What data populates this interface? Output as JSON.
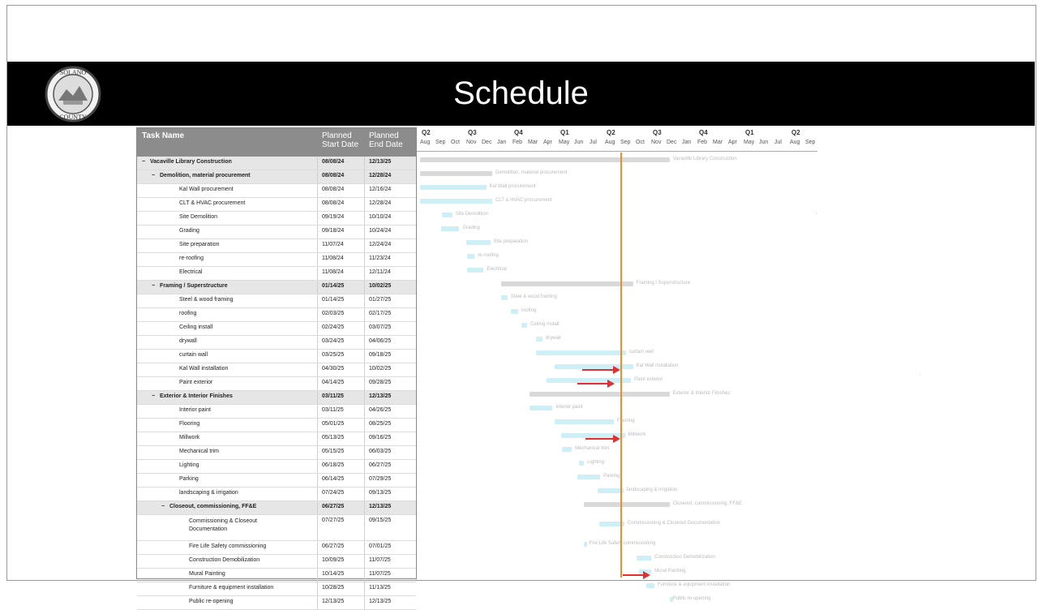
{
  "slide": {
    "title": "Schedule",
    "seal_text_top": "SOLANO",
    "seal_text_bottom": "COUNTY"
  },
  "table": {
    "headers": {
      "task": "Task Name",
      "start_line1": "Planned",
      "start_line2": "Start Date",
      "end_line1": "Planned",
      "end_line2": "End Date"
    },
    "rows": [
      {
        "name": "Vacaville Library Construction",
        "start": "08/08/24",
        "end": "12/13/25",
        "level": 0,
        "group": true,
        "toggle": "−"
      },
      {
        "name": "Demolition, material procurement",
        "start": "08/08/24",
        "end": "12/28/24",
        "level": 1,
        "group": true,
        "toggle": "−"
      },
      {
        "name": "Kal Wall procurement",
        "start": "08/08/24",
        "end": "12/16/24",
        "level": 2
      },
      {
        "name": "CLT & HVAC procurement",
        "start": "08/08/24",
        "end": "12/28/24",
        "level": 2
      },
      {
        "name": "Site Demolition",
        "start": "09/19/24",
        "end": "10/10/24",
        "level": 2
      },
      {
        "name": "Grading",
        "start": "09/18/24",
        "end": "10/24/24",
        "level": 2
      },
      {
        "name": "Site preparation",
        "start": "11/07/24",
        "end": "12/24/24",
        "level": 2
      },
      {
        "name": "re-roofing",
        "start": "11/08/24",
        "end": "11/23/24",
        "level": 2
      },
      {
        "name": "Electrical",
        "start": "11/08/24",
        "end": "12/11/24",
        "level": 2
      },
      {
        "name": "Framing / Superstructure",
        "start": "01/14/25",
        "end": "10/02/25",
        "level": 1,
        "group": true,
        "toggle": "−"
      },
      {
        "name": "Steel & wood framing",
        "start": "01/14/25",
        "end": "01/27/25",
        "level": 2
      },
      {
        "name": "roofing",
        "start": "02/03/25",
        "end": "02/17/25",
        "level": 2
      },
      {
        "name": "Ceiling install",
        "start": "02/24/25",
        "end": "03/07/25",
        "level": 2
      },
      {
        "name": "drywall",
        "start": "03/24/25",
        "end": "04/06/25",
        "level": 2
      },
      {
        "name": "curtain wall",
        "start": "03/25/25",
        "end": "09/18/25",
        "level": 2
      },
      {
        "name": "Kal Wall installation",
        "start": "04/30/25",
        "end": "10/02/25",
        "level": 2
      },
      {
        "name": "Paint exterior",
        "start": "04/14/25",
        "end": "09/28/25",
        "level": 2
      },
      {
        "name": "Exterior & Interior Finishes",
        "start": "03/11/25",
        "end": "12/13/25",
        "level": 1,
        "group": true,
        "toggle": "−"
      },
      {
        "name": "Interior paint",
        "start": "03/11/25",
        "end": "04/26/25",
        "level": 2
      },
      {
        "name": "Flooring",
        "start": "05/01/25",
        "end": "08/25/25",
        "level": 2
      },
      {
        "name": "Millwork",
        "start": "05/13/25",
        "end": "09/16/25",
        "level": 2
      },
      {
        "name": "Mechanical trim",
        "start": "05/15/25",
        "end": "06/03/25",
        "level": 2
      },
      {
        "name": "Lighting",
        "start": "06/18/25",
        "end": "06/27/25",
        "level": 2
      },
      {
        "name": "Parking",
        "start": "06/14/25",
        "end": "07/29/25",
        "level": 2
      },
      {
        "name": "landscaping & irrigation",
        "start": "07/24/25",
        "end": "09/13/25",
        "level": 2
      },
      {
        "name": "Closeout, commissioning, FF&E",
        "start": "06/27/25",
        "end": "12/13/25",
        "level": 2,
        "group": true,
        "toggle": "−"
      },
      {
        "name": "Commissioning & Closeout Documentation",
        "start": "07/27/25",
        "end": "09/15/25",
        "level": 3,
        "tall": true
      },
      {
        "name": "Fire Life Safety commissioning",
        "start": "06/27/25",
        "end": "07/01/25",
        "level": 3
      },
      {
        "name": "Construction Demobilization",
        "start": "10/09/25",
        "end": "11/07/25",
        "level": 3
      },
      {
        "name": "Mural Painting",
        "start": "10/14/25",
        "end": "11/07/25",
        "level": 3
      },
      {
        "name": "Furniture & equipment installation",
        "start": "10/28/25",
        "end": "11/13/25",
        "level": 3
      },
      {
        "name": "Public re-opening",
        "start": "12/13/25",
        "end": "12/13/25",
        "level": 3
      }
    ]
  },
  "timeline": {
    "quarters": [
      {
        "label": "Q2"
      },
      {
        "label": "Q3"
      },
      {
        "label": "Q4"
      },
      {
        "label": "Q1"
      },
      {
        "label": "Q2"
      },
      {
        "label": "Q3"
      },
      {
        "label": "Q4"
      },
      {
        "label": "Q1"
      },
      {
        "label": "Q2"
      }
    ],
    "months": [
      "Aug",
      "Sep",
      "Oct",
      "Nov",
      "Dec",
      "Jan",
      "Feb",
      "Mar",
      "Apr",
      "May",
      "Jun",
      "Jul",
      "Aug",
      "Sep",
      "Oct",
      "Nov",
      "Dec",
      "Jan",
      "Feb",
      "Mar",
      "Apr",
      "May",
      "Jun",
      "Jul",
      "Aug",
      "Sep"
    ],
    "bar_labels": [
      "Vacaville Library Construction",
      "Demolition, material procurement",
      "Kal Wall procurement",
      "CLT & HVAC procurement",
      "Site Demolition",
      "Grading",
      "Site preparation",
      "re-roofing",
      "Electrical",
      "Framing / Superstructure",
      "Steel & wood framing",
      "roofing",
      "Ceiling install",
      "drywall",
      "curtain wall",
      "Kal Wall installation",
      "Paint exterior",
      "Exterior & Interior Finishes",
      "Interior paint",
      "Flooring",
      "Millwork",
      "Mechanical trim",
      "Lighting",
      "Parking",
      "landscaping & irrigation",
      "Closeout, commissioning, FF&E",
      "Commissioning & Closeout Documentation",
      "Fire Life Safety commissioning",
      "Construction Demobilization",
      "Mural Painting",
      "Furniture & equipment installation",
      "Public re-opening"
    ]
  },
  "colors": {
    "title_bar": "#000000",
    "header": "#8c8c8c",
    "task_bar": "#cfeff6",
    "summary_bar": "#d9d9d9",
    "today_line": "#f28c28",
    "arrow": "#e03030"
  }
}
